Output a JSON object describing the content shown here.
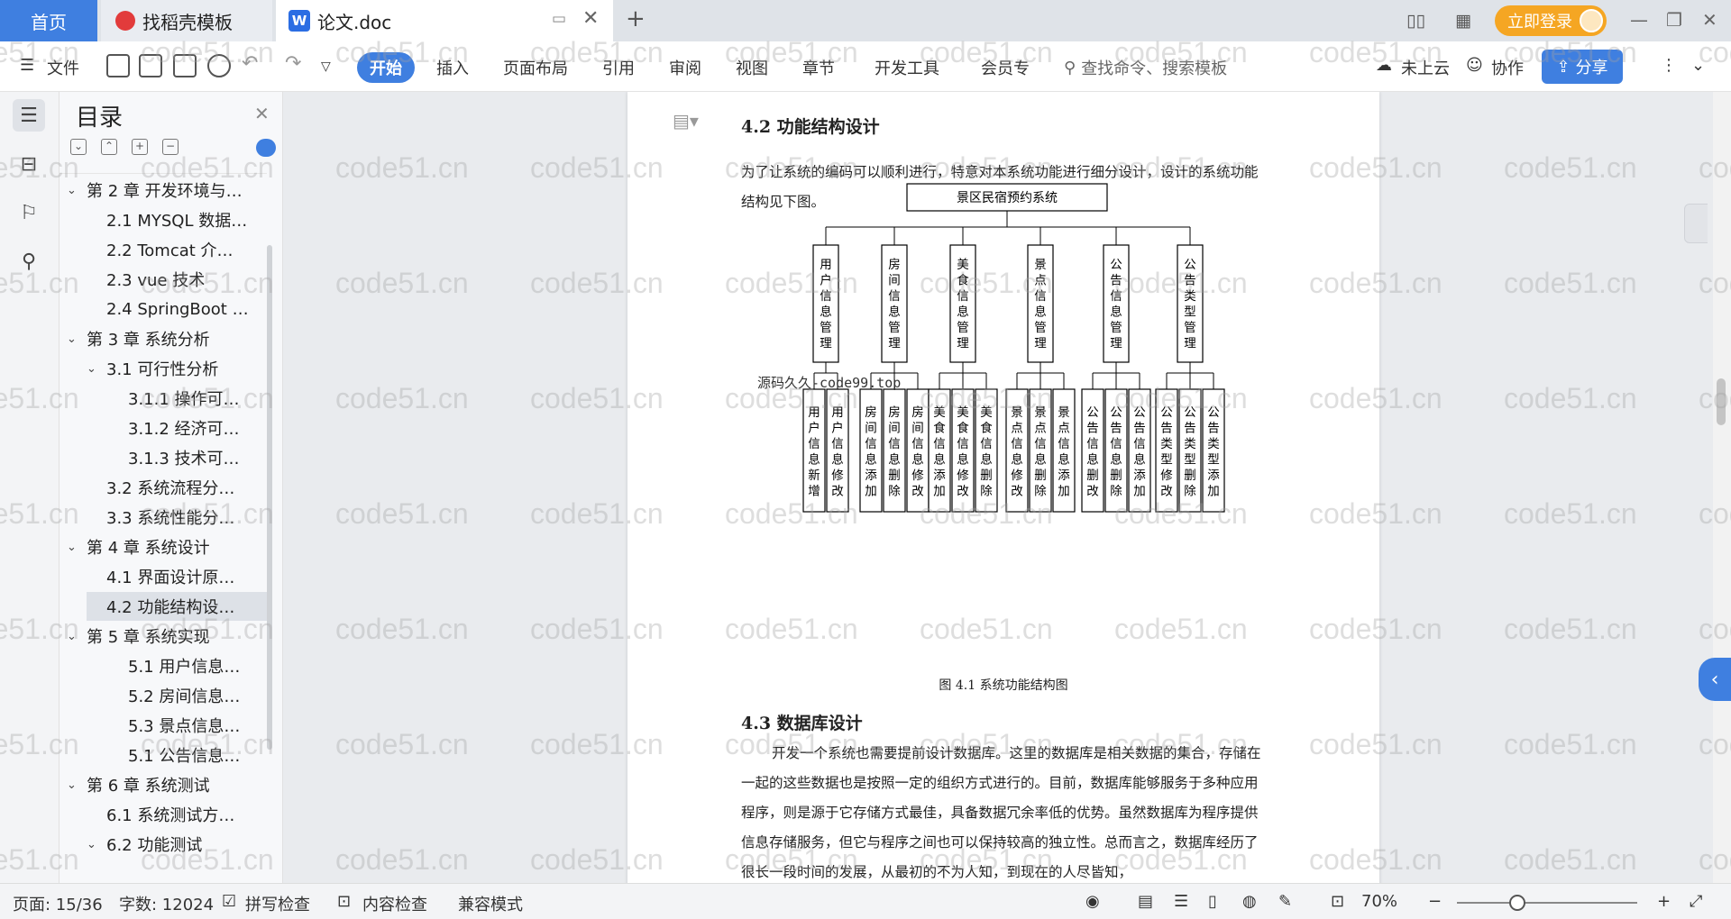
{
  "tabs": {
    "home": "首页",
    "templates": "找稻壳模板",
    "document": "论文.doc",
    "new_tab": "+",
    "login": "立即登录"
  },
  "toolbar": {
    "file": "文件",
    "menu": [
      "开始",
      "插入",
      "页面布局",
      "引用",
      "审阅",
      "视图",
      "章节",
      "开发工具",
      "会员专"
    ],
    "search_placeholder": "查找命令、搜索模板",
    "cloud": "未上云",
    "collab": "协作",
    "share": "分享"
  },
  "toc": {
    "title": "目录",
    "items": [
      {
        "label": "第 2 章  开发环境与…",
        "level": 1,
        "chev": "v"
      },
      {
        "label": "2.1 MYSQL 数据…",
        "level": 2,
        "chev": ""
      },
      {
        "label": "2.2 Tomcat  介…",
        "level": 2,
        "chev": ""
      },
      {
        "label": "2.3 vue 技术",
        "level": 2,
        "chev": ""
      },
      {
        "label": "2.4 SpringBoot …",
        "level": 2,
        "chev": ""
      },
      {
        "label": "第 3 章  系统分析",
        "level": 1,
        "chev": "v"
      },
      {
        "label": "3.1 可行性分析",
        "level": 2,
        "chev": "v"
      },
      {
        "label": "3.1.1 操作可…",
        "level": 3,
        "chev": ""
      },
      {
        "label": "3.1.2 经济可…",
        "level": 3,
        "chev": ""
      },
      {
        "label": "3.1.3 技术可…",
        "level": 3,
        "chev": ""
      },
      {
        "label": "3.2 系统流程分…",
        "level": 2,
        "chev": ""
      },
      {
        "label": "3.3 系统性能分…",
        "level": 2,
        "chev": ""
      },
      {
        "label": "第 4 章  系统设计",
        "level": 1,
        "chev": "v"
      },
      {
        "label": "4.1 界面设计原…",
        "level": 2,
        "chev": ""
      },
      {
        "label": "4.2 功能结构设…",
        "level": 2,
        "chev": "",
        "selected": true
      },
      {
        "label": "第 5 章  系统实现",
        "level": 1,
        "chev": "v"
      },
      {
        "label": "5.1 用户信息…",
        "level": 3,
        "chev": ""
      },
      {
        "label": "5.2  房间信息…",
        "level": 3,
        "chev": ""
      },
      {
        "label": "5.3 景点信息…",
        "level": 3,
        "chev": ""
      },
      {
        "label": "5.1 公告信息…",
        "level": 3,
        "chev": ""
      },
      {
        "label": "第 6 章  系统测试",
        "level": 1,
        "chev": "v"
      },
      {
        "label": "6.1  系统测试方…",
        "level": 2,
        "chev": ""
      },
      {
        "label": "6.2  功能测试",
        "level": 2,
        "chev": "v"
      }
    ]
  },
  "document": {
    "heading_42": "4.2 功能结构设计",
    "intro": "为了让系统的编码可以顺利进行，特意对本系统功能进行细分设计，设计的系统功能结构见下图。",
    "diagram": {
      "root": "景区民宿预约系统",
      "modules": [
        {
          "name": "用户信息管理",
          "leaves": [
            "用户信息新增",
            "用户信息修改"
          ]
        },
        {
          "name": "房间信息管理",
          "leaves": [
            "房间信息添加",
            "房间信息删除",
            "房间信息修改"
          ]
        },
        {
          "name": "美食信息管理",
          "leaves": [
            "美食信息添加",
            "美食信息修改",
            "美食信息删除"
          ]
        },
        {
          "name": "景点信息管理",
          "leaves": [
            "景点信息修改",
            "景点信息删除",
            "景点信息添加"
          ]
        },
        {
          "name": "公告信息管理",
          "leaves": [
            "公告信息删改",
            "公告信息删除",
            "公告信息添加"
          ]
        },
        {
          "name": "公告类型管理",
          "leaves": [
            "公告类型修改",
            "公告类型删除",
            "公告类型添加"
          ]
        }
      ],
      "overlay_text": "源码久久-code99.top"
    },
    "caption": "图 4.1  系统功能结构图",
    "heading_43": "4.3  数据库设计",
    "body": "开发一个系统也需要提前设计数据库。这里的数据库是相关数据的集合，存储在一起的这些数据也是按照一定的组织方式进行的。目前，数据库能够服务于多种应用程序，则是源于它存储方式最佳，具备数据冗余率低的优势。虽然数据库为程序提供信息存储服务，但它与程序之间也可以保持较高的独立性。总而言之，数据库经历了很长一段时间的发展，从最初的不为人知，到现在的人尽皆知，"
  },
  "watermark": "code51.cn",
  "status": {
    "page": "页面: 15/36",
    "words": "字数: 12024",
    "spell": "拼写检查",
    "content_check": "内容检查",
    "compat": "兼容模式",
    "zoom": "70%"
  },
  "colors": {
    "accent": "#3f7fe0",
    "login": "#f5a623"
  }
}
